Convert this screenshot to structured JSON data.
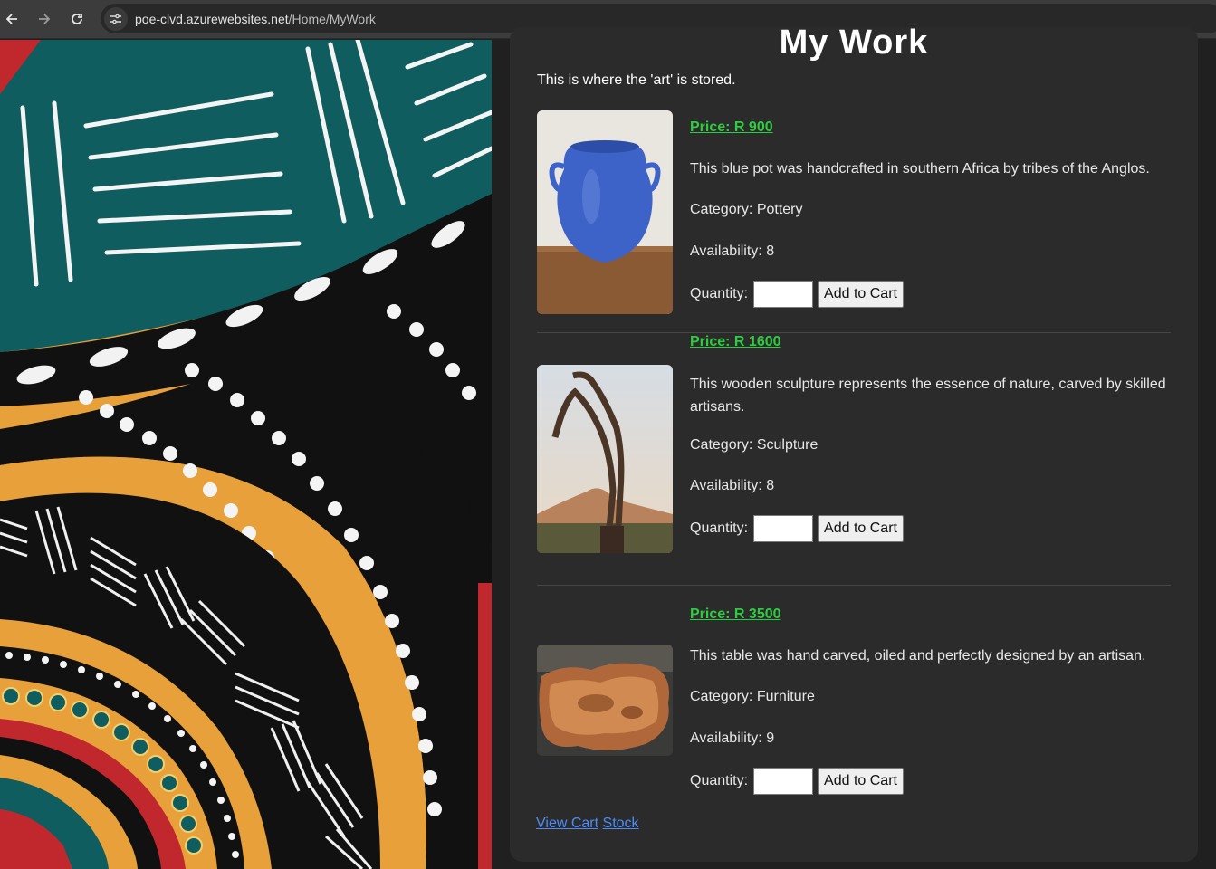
{
  "browser": {
    "back_icon": "arrow-left-icon",
    "forward_icon": "arrow-right-icon",
    "reload_icon": "reload-icon",
    "site_info_icon": "tune-icon",
    "url_host": "poe-clvd.azurewebsites.net",
    "url_path": "/Home/MyWork"
  },
  "page": {
    "heading": "My Work",
    "intro": "This is where the 'art' is stored."
  },
  "items": [
    {
      "price": "Price: R 900",
      "description": "This blue pot was handcrafted in southern Africa by tribes of the Anglos.",
      "category": "Category: Pottery",
      "availability": "Availability: 8",
      "quantity_label": "Quantity:",
      "quantity_value": "",
      "button": "Add to Cart"
    },
    {
      "price": "Price: R 1600",
      "description": "This wooden sculpture represents the essence of nature, carved by skilled artisans.",
      "category": "Category: Sculpture",
      "availability": "Availability: 8",
      "quantity_label": "Quantity:",
      "quantity_value": "",
      "button": "Add to Cart"
    },
    {
      "price": "Price: R 3500",
      "description": "This table was hand carved, oiled and perfectly designed by an artisan.",
      "category": "Category: Furniture",
      "availability": "Availability: 9",
      "quantity_label": "Quantity:",
      "quantity_value": "",
      "button": "Add to Cart"
    }
  ],
  "links": {
    "view_cart": "View Cart",
    "stock": "Stock"
  },
  "colors": {
    "price_green": "#2ecc40",
    "link_blue": "#4c8bf5",
    "panel_bg": "#2b2b2b"
  }
}
